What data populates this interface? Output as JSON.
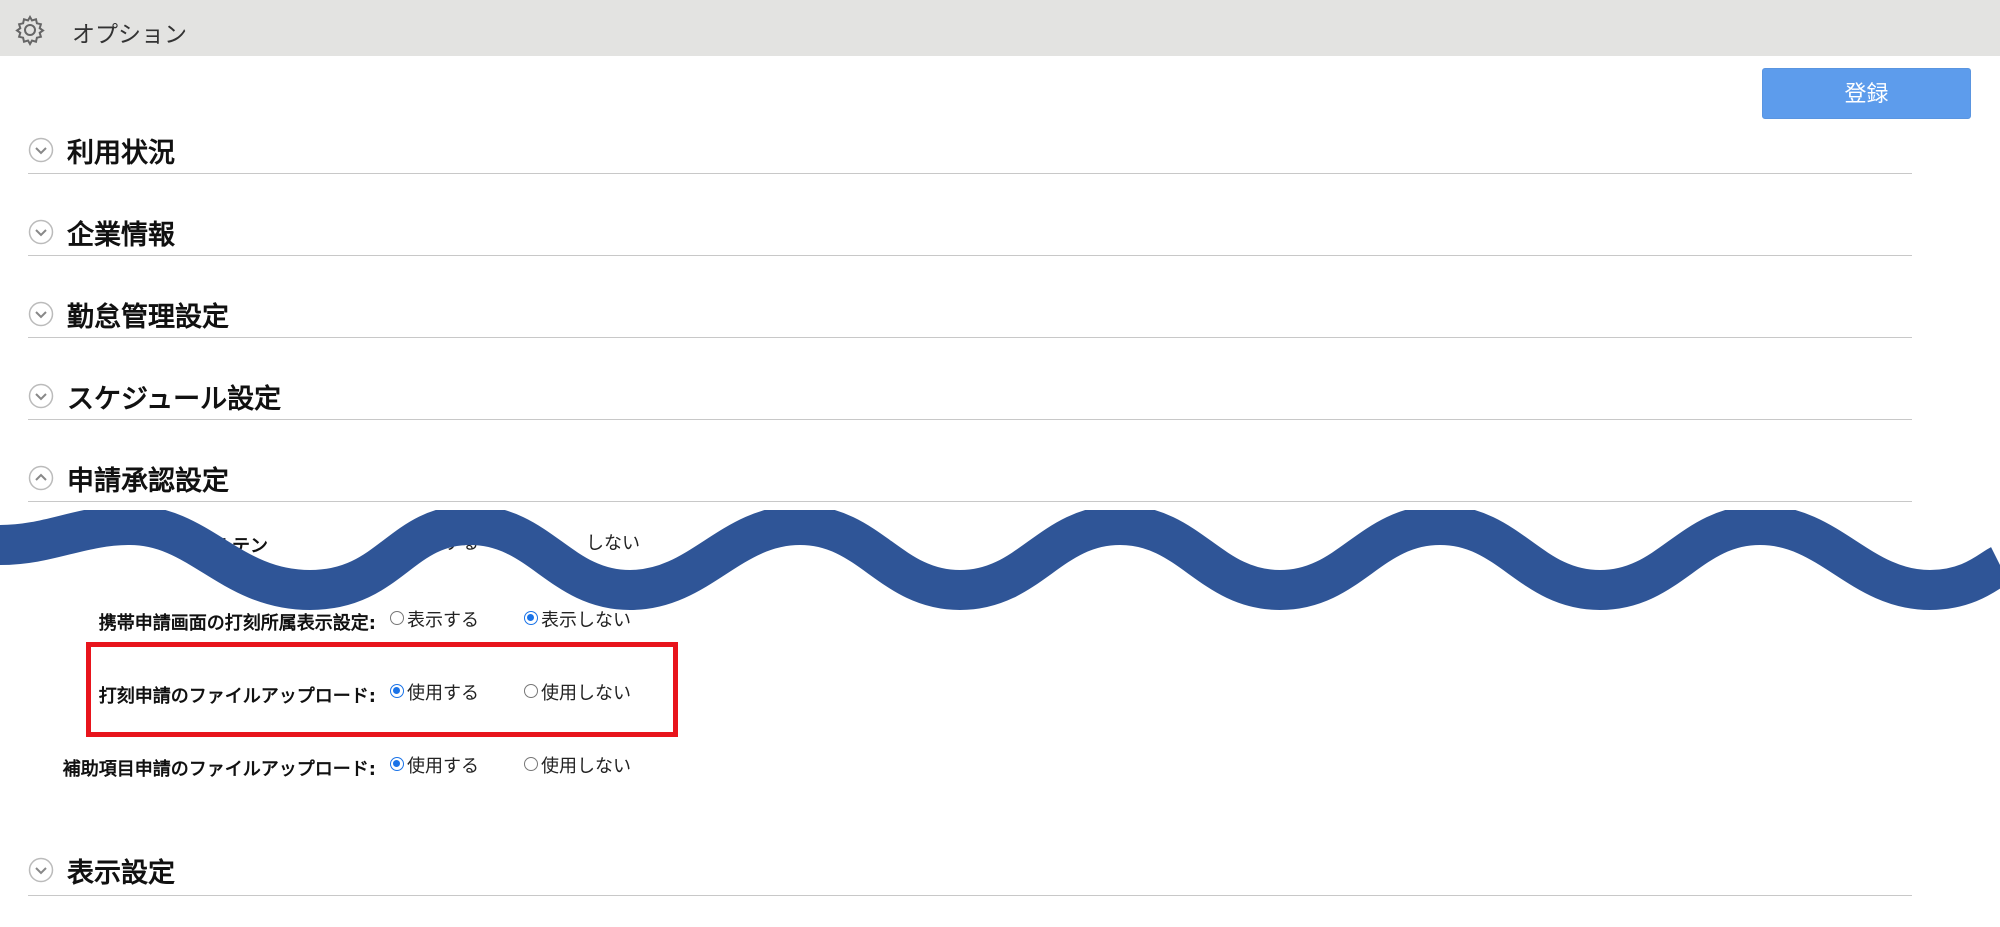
{
  "header": {
    "title": "オプション",
    "icon": "gear-icon"
  },
  "toolbar": {
    "register_label": "登録"
  },
  "sections": [
    {
      "title": "利用状況",
      "expanded": false
    },
    {
      "title": "企業情報",
      "expanded": false
    },
    {
      "title": "勤怠管理設定",
      "expanded": false
    },
    {
      "title": "スケジュール設定",
      "expanded": false
    },
    {
      "title": "申請承認設定",
      "expanded": true
    },
    {
      "title": "表示設定",
      "expanded": false
    }
  ],
  "approval_settings": [
    {
      "label": "メールテン",
      "options": [
        "使用する",
        "しない"
      ],
      "selected": 0,
      "partially_obscured": true
    },
    {
      "label": "携帯申請画面の打刻所属表示設定:",
      "options": [
        "表示する",
        "表示しない"
      ],
      "selected": 1
    },
    {
      "label": "打刻申請のファイルアップロード:",
      "options": [
        "使用する",
        "使用しない"
      ],
      "selected": 0,
      "highlighted": true
    },
    {
      "label": "補助項目申請のファイルアップロード:",
      "options": [
        "使用する",
        "使用しない"
      ],
      "selected": 0
    }
  ],
  "colors": {
    "accent": "#5d9cec",
    "radio_selected": "#1a73e8",
    "highlight_border": "#e8141c",
    "wave": "#2f5597",
    "topbar": "#e3e3e1"
  }
}
